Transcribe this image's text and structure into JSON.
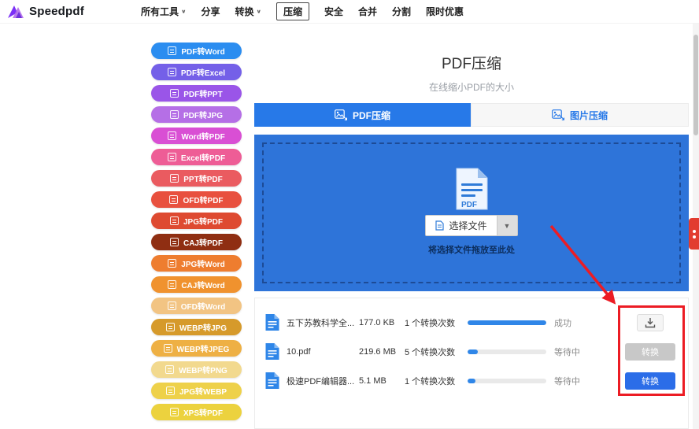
{
  "colors": {
    "accent_blue": "#2779e8",
    "dropzone_blue": "#2e74d9",
    "annotation_red": "#ec1c24",
    "progress_blue": "#2f86e8"
  },
  "brand": {
    "name": "Speedpdf"
  },
  "nav": {
    "items": [
      {
        "label": "所有工具",
        "caret": "∨"
      },
      {
        "label": "分享"
      },
      {
        "label": "转换",
        "caret": "∨"
      },
      {
        "label": "压缩"
      },
      {
        "label": "安全"
      },
      {
        "label": "合并"
      },
      {
        "label": "分割"
      },
      {
        "label": "限时优惠"
      }
    ]
  },
  "sidebar": {
    "items": [
      {
        "label": "PDF转Word",
        "color": "#2b8df0"
      },
      {
        "label": "PDF转Excel",
        "color": "#7460e8"
      },
      {
        "label": "PDF转PPT",
        "color": "#9a55e8"
      },
      {
        "label": "PDF转JPG",
        "color": "#b56fe6"
      },
      {
        "label": "Word转PDF",
        "color": "#d94fd4"
      },
      {
        "label": "Excel转PDF",
        "color": "#ee5d96"
      },
      {
        "label": "PPT转PDF",
        "color": "#ea5b60"
      },
      {
        "label": "OFD转PDF",
        "color": "#e8503e"
      },
      {
        "label": "JPG转PDF",
        "color": "#de4a31"
      },
      {
        "label": "CAJ转PDF",
        "color": "#8f2e12"
      },
      {
        "label": "JPG转Word",
        "color": "#ee7d2f"
      },
      {
        "label": "CAJ转Word",
        "color": "#f0922e"
      },
      {
        "label": "OFD转Word",
        "color": "#f2c483"
      },
      {
        "label": "WEBP转JPG",
        "color": "#d69a2b"
      },
      {
        "label": "WEBP转JPEG",
        "color": "#eeb044"
      },
      {
        "label": "WEBP转PNG",
        "color": "#f2d98e"
      },
      {
        "label": "JPG转WEBP",
        "color": "#eed14a"
      },
      {
        "label": "XPS转PDF",
        "color": "#ecd23e"
      }
    ]
  },
  "main": {
    "title": "PDF压缩",
    "subtitle": "在线缩小PDF的大小",
    "tabs": [
      {
        "label": "PDF压缩"
      },
      {
        "label": "图片压缩"
      }
    ],
    "dropzone": {
      "file_icon_label": "PDF",
      "select_button": "选择文件",
      "hint": "将选择文件拖放至此处"
    },
    "files": {
      "rows": [
        {
          "name": "五下苏教科学全...",
          "size": "177.0 KB",
          "count": "1 个转换次数",
          "progress": 100,
          "status": "成功"
        },
        {
          "name": "10.pdf",
          "size": "219.6 MB",
          "count": "5 个转换次数",
          "progress": 13,
          "status": "等待中",
          "action": "转换"
        },
        {
          "name": "极速PDF编辑器...",
          "size": "5.1 MB",
          "count": "1 个转换次数",
          "progress": 10,
          "status": "等待中",
          "action": "转换"
        }
      ]
    }
  }
}
